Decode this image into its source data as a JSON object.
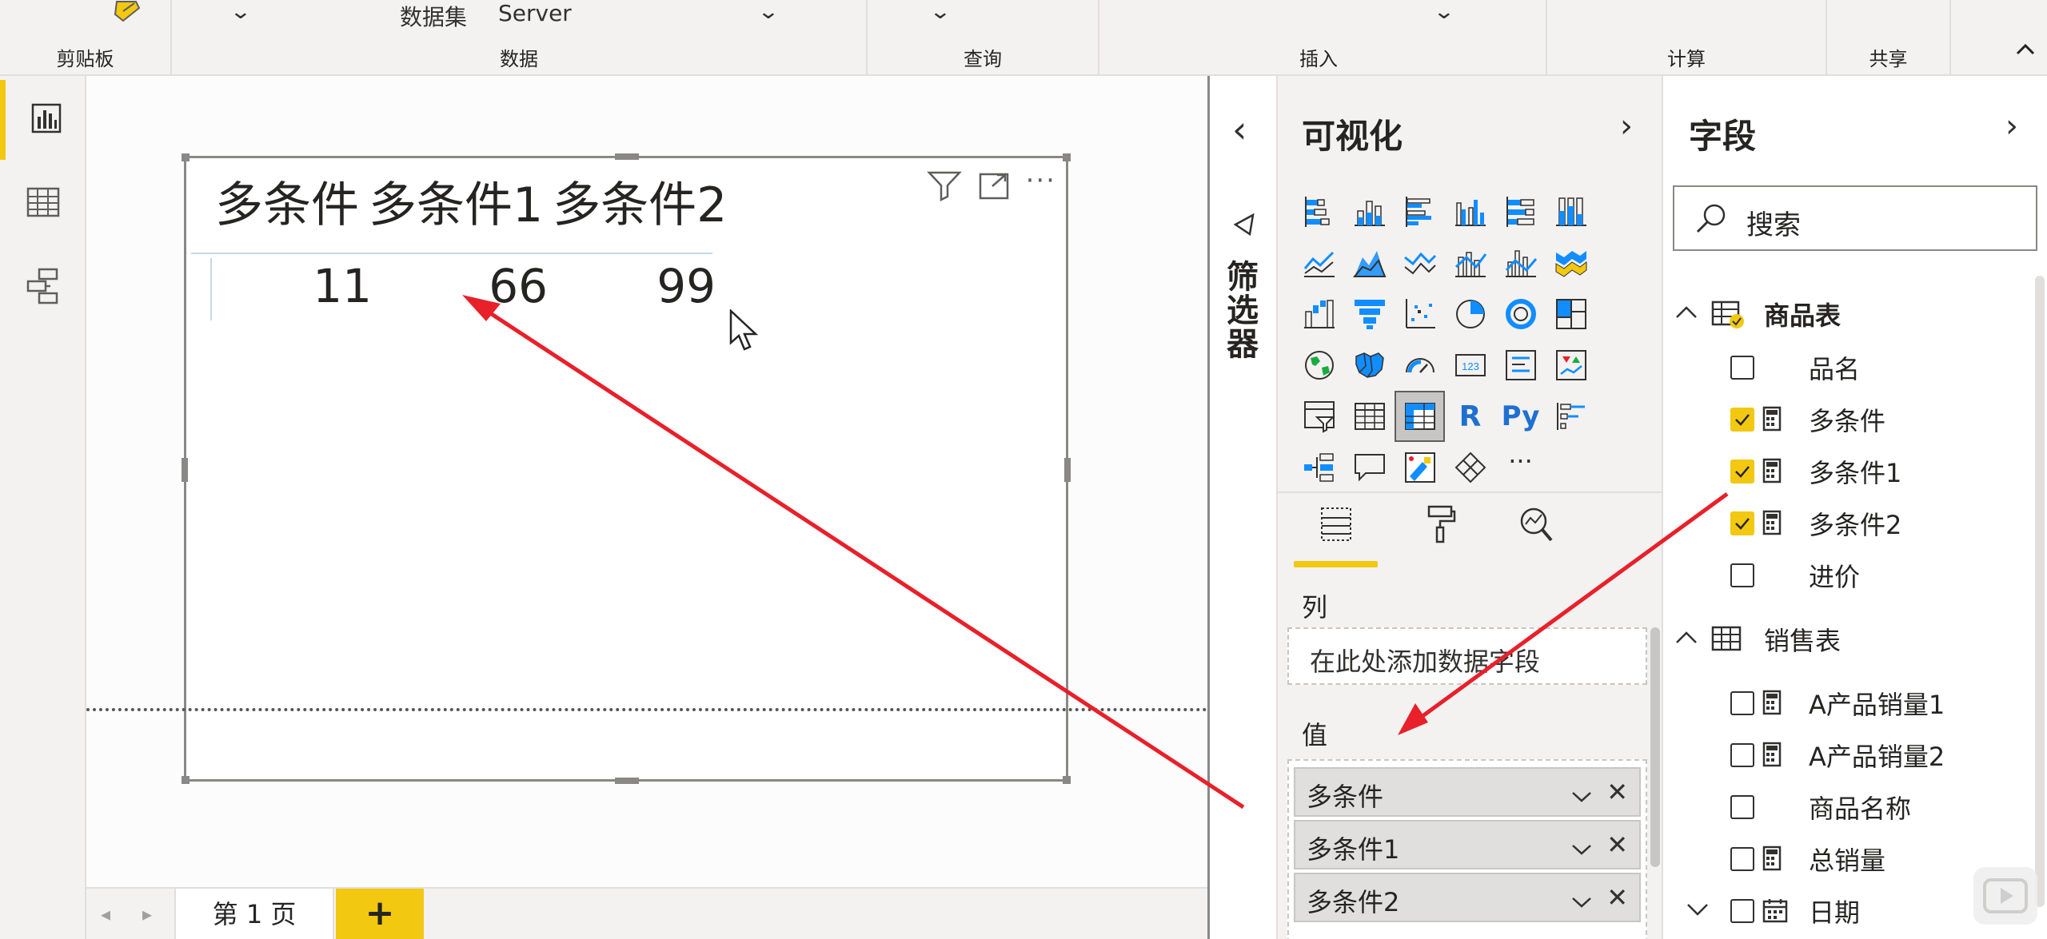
{
  "ribbon": {
    "groups": [
      {
        "label": "剪贴板"
      },
      {
        "label": "数据"
      },
      {
        "label": "查询"
      },
      {
        "label": "插入"
      },
      {
        "label": "计算"
      },
      {
        "label": "共享"
      }
    ],
    "dataset_label": "数据集",
    "server_label": "Server"
  },
  "leftnav": [
    {
      "name": "report-view",
      "icon": "bar-chart-icon",
      "active": true
    },
    {
      "name": "data-view",
      "icon": "table-grid-icon",
      "active": false
    },
    {
      "name": "model-view",
      "icon": "model-icon",
      "active": false
    }
  ],
  "visual": {
    "headers": [
      "多条件",
      "多条件1",
      "多条件2"
    ],
    "values": [
      "11",
      "66",
      "99"
    ]
  },
  "pages": {
    "tab_label": "第 1 页",
    "add_label": "+"
  },
  "filters": {
    "label": "筛选器",
    "collapse_arrow": "‹"
  },
  "viz_pane": {
    "title": "可视化",
    "arrow": "›",
    "more": "···",
    "r_label": "R",
    "py_label": "Py",
    "kpi_label": "123",
    "columns_label": "列",
    "columns_placeholder": "在此处添加数据字段",
    "values_label": "值",
    "value_fields": [
      {
        "label": "多条件"
      },
      {
        "label": "多条件1"
      },
      {
        "label": "多条件2"
      }
    ],
    "remove": "✕"
  },
  "fields_pane": {
    "title": "字段",
    "arrow": "›",
    "search_placeholder": "搜索",
    "tables": [
      {
        "name": "商品表",
        "expanded": true,
        "fields": [
          {
            "label": "品名",
            "checked": false,
            "measure": false
          },
          {
            "label": "多条件",
            "checked": true,
            "measure": true
          },
          {
            "label": "多条件1",
            "checked": true,
            "measure": true
          },
          {
            "label": "多条件2",
            "checked": true,
            "measure": true
          },
          {
            "label": "进价",
            "checked": false,
            "measure": false
          }
        ]
      },
      {
        "name": "销售表",
        "expanded": true,
        "fields": [
          {
            "label": "A产品销量1",
            "checked": false,
            "measure": true
          },
          {
            "label": "A产品销量2",
            "checked": false,
            "measure": true
          },
          {
            "label": "商品名称",
            "checked": false,
            "measure": false
          },
          {
            "label": "总销量",
            "checked": false,
            "measure": true
          },
          {
            "label": "日期",
            "checked": false,
            "measure": false,
            "calendar": true
          }
        ]
      }
    ]
  },
  "colors": {
    "accent": "#f2c811",
    "annotation_arrow": "#e8202a",
    "chart_blue": "#118dff"
  }
}
